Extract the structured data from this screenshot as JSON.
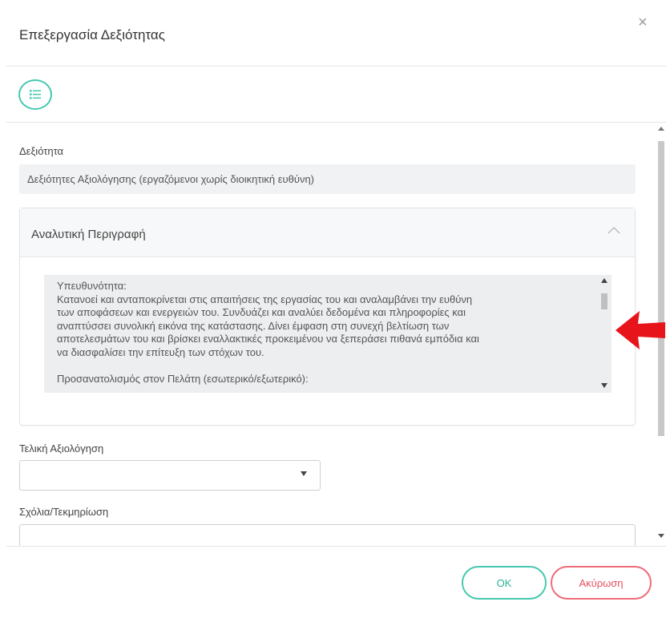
{
  "dialog": {
    "title": "Επεξεργασία Δεξιότητας",
    "close_symbol": "×",
    "toolbar": {
      "icon": "list-icon"
    }
  },
  "form": {
    "skill_label": "Δεξιότητα",
    "skill_value": "Δεξιότητες Αξιολόγησης (εργαζόμενοι χωρίς διοικητική ευθύνη)",
    "panel": {
      "title": "Αναλυτική Περιγραφή",
      "expanded": true,
      "description": "Υπευθυνότητα:\nΚατανοεί και ανταποκρίνεται στις απαιτήσεις της εργασίας του και αναλαμβάνει την ευθύνη\nτων αποφάσεων και ενεργειών του. Συνδυάζει και αναλύει δεδομένα και πληροφορίες και\nαναπτύσσει συνολική εικόνα της κατάστασης. Δίνει έμφαση στη συνεχή βελτίωση των\nαποτελεσμάτων του και βρίσκει εναλλακτικές προκειμένου να ξεπεράσει πιθανά εμπόδια και\nνα διασφαλίσει την επίτευξη των στόχων του.\n\nΠροσανατολισμός στον Πελάτη (εσωτερικό/εξωτερικό):"
    },
    "final_rating_label": "Τελική Αξιολόγηση",
    "final_rating_value": "",
    "comments_label": "Σχόλια/Τεκμηρίωση",
    "comments_value": ""
  },
  "buttons": {
    "ok": "OK",
    "cancel": "Ακύρωση"
  },
  "colors": {
    "accent": "#46c8b0",
    "danger": "#ef6b78",
    "arrow": "#e8141b"
  }
}
